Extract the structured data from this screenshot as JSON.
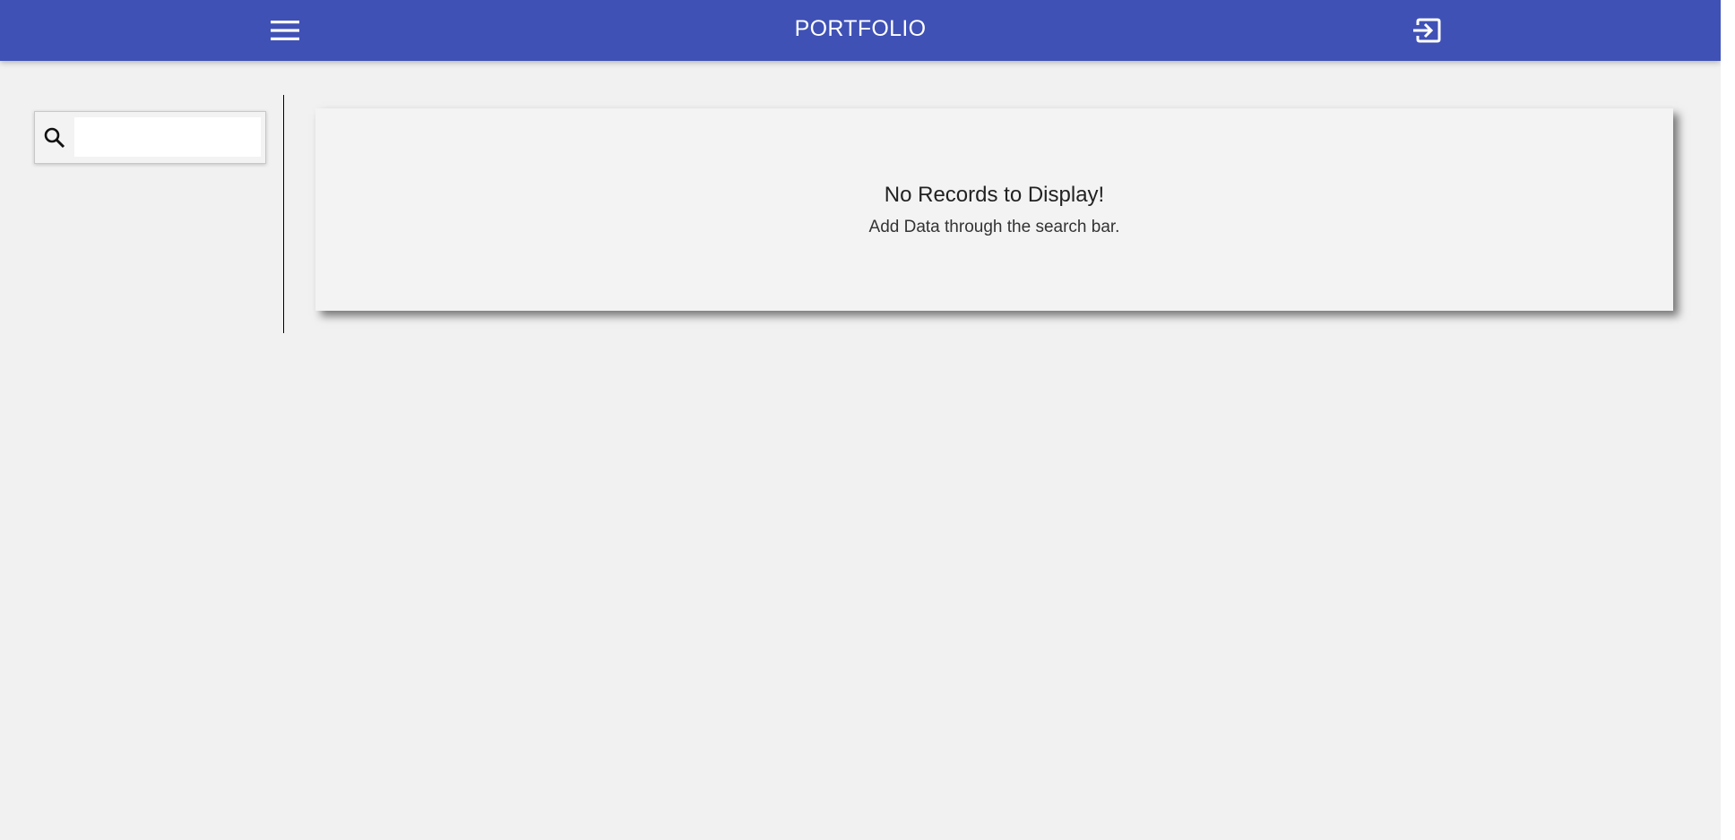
{
  "app_bar": {
    "title": "PORTFOLIO",
    "background_color": "#3f51b5",
    "menu_icon": "hamburger-menu-icon",
    "logout_icon": "logout-icon"
  },
  "sidebar": {
    "search": {
      "icon": "search-icon",
      "value": "",
      "placeholder": ""
    }
  },
  "main": {
    "empty_state": {
      "heading": "No Records to Display!",
      "subtext": "Add Data through the search bar."
    }
  }
}
